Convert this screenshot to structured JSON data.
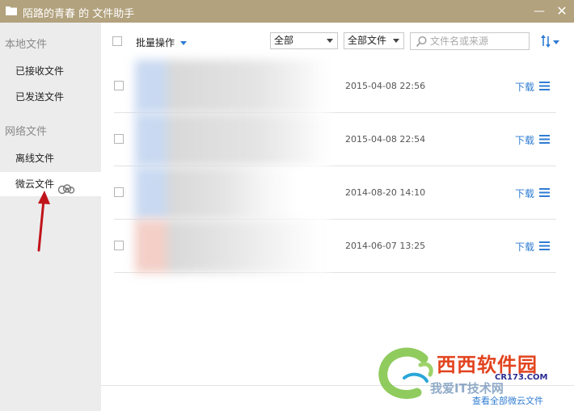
{
  "window": {
    "title": "陌路的青春 的 文件助手",
    "minimize_symbol": "—",
    "close_symbol": "✕",
    "bar_color": "#b2a27d"
  },
  "sidebar": {
    "local_section": "本地文件",
    "local_items": [
      {
        "label": "已接收文件"
      },
      {
        "label": "已发送文件"
      }
    ],
    "network_section": "网络文件",
    "network_items": [
      {
        "label": "离线文件"
      },
      {
        "label": "微云文件",
        "icon": "cloud-icon",
        "active": true
      }
    ]
  },
  "toolbar": {
    "batch_label": "批量操作",
    "filter_source": {
      "value": "全部"
    },
    "filter_type": {
      "value": "全部文件"
    },
    "search": {
      "placeholder": "文件名或来源",
      "value": ""
    },
    "sort_icon": "sort-icon"
  },
  "files": [
    {
      "date": "2015-04-08 22:56",
      "download_label": "下载",
      "thumb_color": "#c9d9f1"
    },
    {
      "date": "2015-04-08 22:54",
      "download_label": "下载",
      "thumb_color": "#c9d9f1"
    },
    {
      "date": "2014-08-20 14:10",
      "download_label": "下载",
      "thumb_color": "#c9d9f1"
    },
    {
      "date": "2014-06-07 13:25",
      "download_label": "下载",
      "thumb_color": "#f3cfc7"
    }
  ],
  "footer": {
    "view_all_label": "查看全部微云文件"
  },
  "watermark": {
    "site_name": "西西软件园",
    "domain": "CR173.COM",
    "slogan": "我爱IT技术网"
  },
  "colors": {
    "accent": "#2f7cd3",
    "sidebar_bg": "#ececec",
    "arrow": "#c0141b"
  }
}
